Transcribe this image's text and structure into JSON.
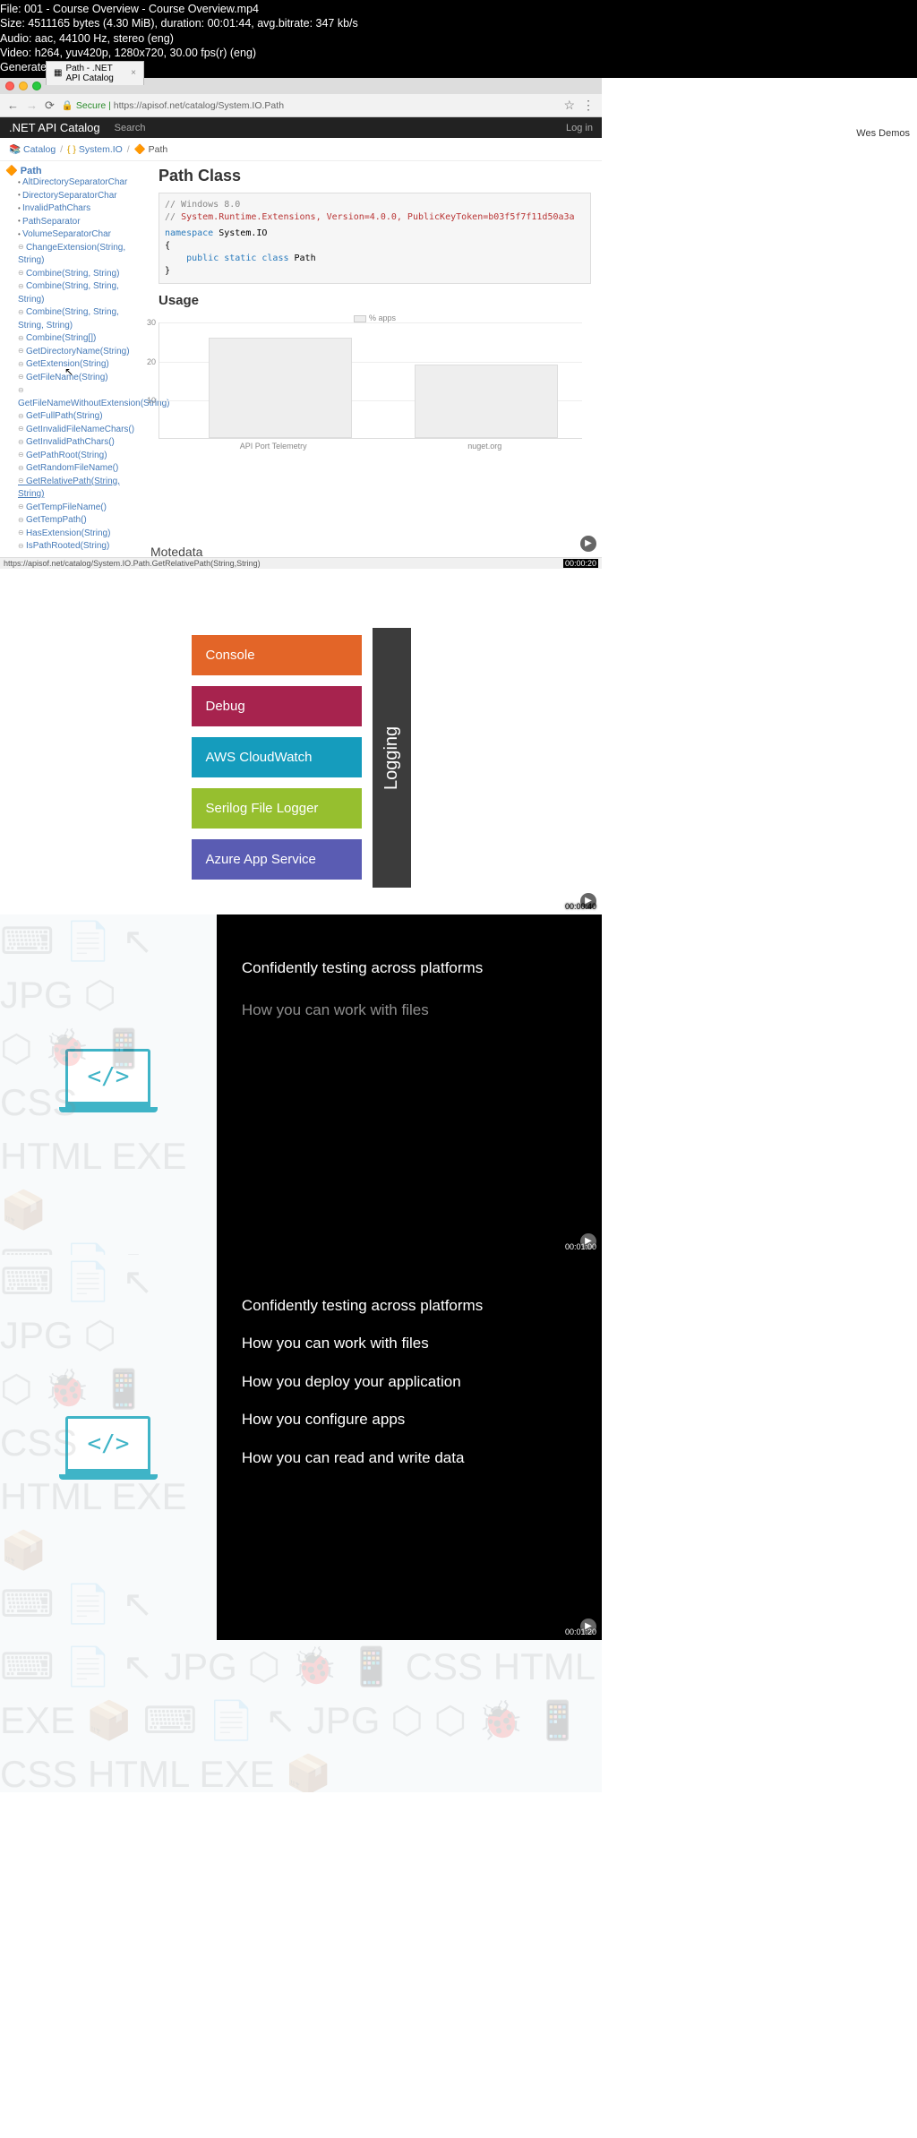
{
  "file_info": {
    "line1": "File: 001 - Course Overview - Course Overview.mp4",
    "line2": "Size: 4511165 bytes (4.30 MiB), duration: 00:01:44, avg.bitrate: 347 kb/s",
    "line3": "Audio: aac, 44100 Hz, stereo (eng)",
    "line4": "Video: h264, yuv420p, 1280x720, 30.00 fps(r) (eng)",
    "line5": "Generated by Thumbnail me"
  },
  "window_title_right": "Wes Demos",
  "tab_title": "Path - .NET API Catalog",
  "url": {
    "scheme": "Secure",
    "host": "https://apisof.net",
    "path": "/catalog/System.IO.Path"
  },
  "topnav": {
    "brand": ".NET API Catalog",
    "search": "Search",
    "login": "Log in"
  },
  "breadcrumb": {
    "icon1": "📚",
    "catalog": "Catalog",
    "ns_icon": "{ }",
    "ns": "System.IO",
    "cls_icon": "🔶",
    "cls": "Path"
  },
  "sidebar": {
    "root": "🔶 Path",
    "items": [
      {
        "t": "AltDirectorySeparatorChar",
        "cls": "field"
      },
      {
        "t": "DirectorySeparatorChar",
        "cls": "field"
      },
      {
        "t": "InvalidPathChars",
        "cls": "field"
      },
      {
        "t": "PathSeparator",
        "cls": "field"
      },
      {
        "t": "VolumeSeparatorChar",
        "cls": "field"
      },
      {
        "t": "ChangeExtension(String, String)"
      },
      {
        "t": "Combine(String, String)"
      },
      {
        "t": "Combine(String, String, String)"
      },
      {
        "t": "Combine(String, String, String, String)"
      },
      {
        "t": "Combine(String[])"
      },
      {
        "t": "GetDirectoryName(String)"
      },
      {
        "t": "GetExtension(String)"
      },
      {
        "t": "GetFileName(String)"
      },
      {
        "t": "GetFileNameWithoutExtension(String)"
      },
      {
        "t": "GetFullPath(String)"
      },
      {
        "t": "GetInvalidFileNameChars()"
      },
      {
        "t": "GetInvalidPathChars()"
      },
      {
        "t": "GetPathRoot(String)"
      },
      {
        "t": "GetRandomFileName()"
      },
      {
        "t": "GetRelativePath(String, String)",
        "cls": "underlined"
      },
      {
        "t": "GetTempFileName()"
      },
      {
        "t": "GetTempPath()"
      },
      {
        "t": "HasExtension(String)"
      },
      {
        "t": "IsPathRooted(String)"
      }
    ]
  },
  "main": {
    "heading": "Path Class",
    "code": {
      "c1": "// Windows 8.0",
      "c2_a": "// System.Runtime.Extensions, Version=4.0.0, PublicKeyToken=b03f5f7f11d50a3a",
      "ns_kw": "namespace",
      "ns_name": "System.IO",
      "brace_o": "{",
      "mods": "public static class",
      "cls": "Path",
      "brace_c": "}"
    },
    "usage_heading": "Usage",
    "metadata_cut": "Motedata"
  },
  "chart_data": {
    "type": "bar",
    "categories": [
      "API Port Telemetry",
      "nuget.org"
    ],
    "values": [
      26,
      19
    ],
    "ylabel": "",
    "ylim": [
      0,
      30
    ],
    "ticks": [
      10,
      20,
      30
    ],
    "legend": "% apps"
  },
  "status_bar_url": "https://apisof.net/catalog/System.IO.Path.GetRelativePath(String,String)",
  "ts1": "00:00:20",
  "logging": {
    "blocks": [
      "Console",
      "Debug",
      "AWS CloudWatch",
      "Serilog File Logger",
      "Azure App Service"
    ],
    "vertical": "Logging"
  },
  "ts2": "00:00:40",
  "summary1": {
    "lines": [
      "Confidently testing across platforms",
      "How you can work with files"
    ]
  },
  "ts3": "00:01:00",
  "summary2": {
    "lines": [
      "Confidently testing across platforms",
      "How you can work with files",
      "How you deploy your application",
      "How you configure apps",
      "How you can read and write data"
    ]
  },
  "ts4": "00:01:20",
  "laptop_code": "</>"
}
